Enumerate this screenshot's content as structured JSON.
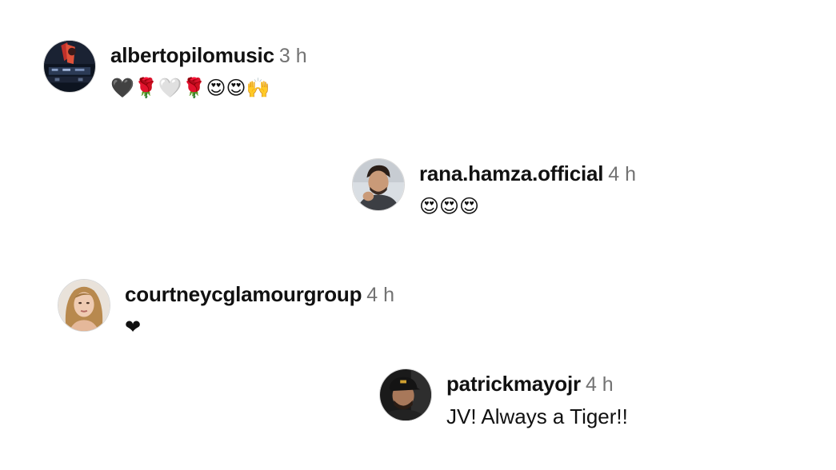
{
  "comments": [
    {
      "username": "albertopilomusic",
      "time": "3 h",
      "text": "🖤🌹🤍🌹😍😍🙌",
      "avatar": "avatar-concert-photo"
    },
    {
      "username": "rana.hamza.official",
      "time": "4 h",
      "text": "😍😍😍",
      "avatar": "avatar-man-photo"
    },
    {
      "username": "courtneycglamourgroup",
      "time": "4 h",
      "text": "❤",
      "avatar": "avatar-woman-photo"
    },
    {
      "username": "patrickmayojr",
      "time": "4 h",
      "text": "JV! Always a Tiger!!",
      "avatar": "avatar-man-cap-photo"
    }
  ]
}
